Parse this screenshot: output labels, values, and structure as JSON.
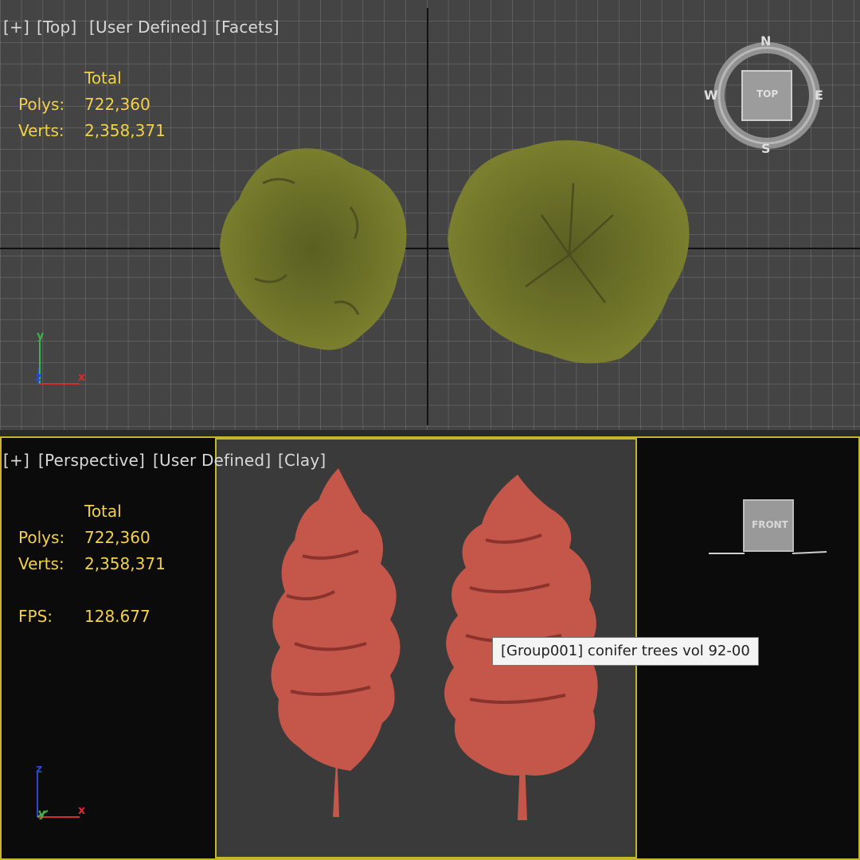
{
  "top_viewport": {
    "label_plus": "[+]",
    "label_view": "[Top]",
    "label_mode": "[User Defined]",
    "label_shading": "[Facets]",
    "stats_header": "Total",
    "polys_label": "Polys:",
    "polys_value": "722,360",
    "verts_label": "Verts:",
    "verts_value": "2,358,371",
    "viewcube_face": "TOP",
    "compass": {
      "n": "N",
      "s": "S",
      "e": "E",
      "w": "W"
    },
    "axis": {
      "x": "x",
      "y": "y",
      "z": "z"
    }
  },
  "perspective_viewport": {
    "label_plus": "[+]",
    "label_view": "[Perspective]",
    "label_mode": "[User Defined]",
    "label_shading": "[Clay]",
    "stats_header": "Total",
    "polys_label": "Polys:",
    "polys_value": "722,360",
    "verts_label": "Verts:",
    "verts_value": "2,358,371",
    "fps_label": "FPS:",
    "fps_value": "128.677",
    "viewcube_face": "FRONT",
    "axis": {
      "x": "x",
      "y": "y",
      "z": "z"
    },
    "tooltip": "[Group001] conifer trees vol 92-00"
  },
  "colors": {
    "stats_text": "#f2d14a",
    "active_frame": "#c6b52c",
    "foliage_top": "#6b7128",
    "clay_tree": "#c4564a",
    "grid_bg": "#444444"
  }
}
